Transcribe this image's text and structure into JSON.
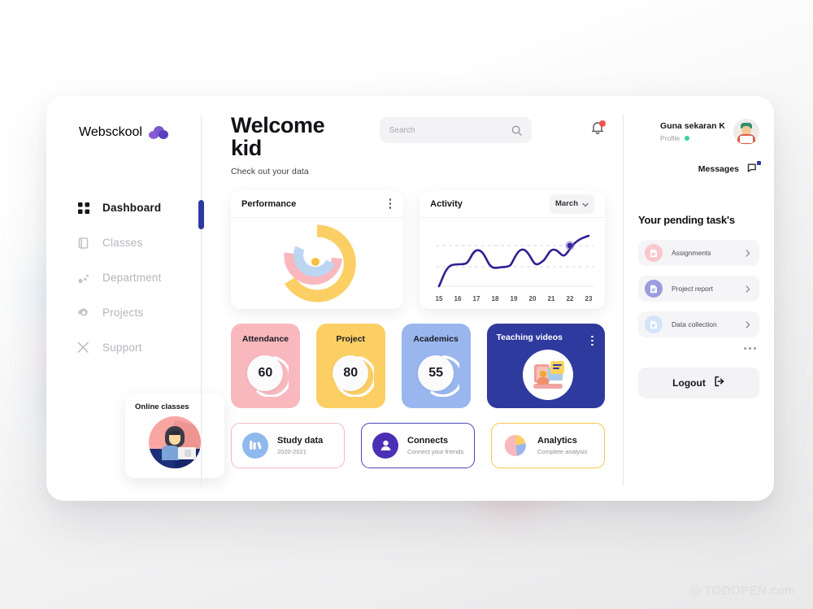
{
  "brand": {
    "name": "Websckool",
    "icon": "cloud-icon"
  },
  "sidebar": {
    "items": [
      {
        "label": "Dashboard",
        "icon": "grid-icon",
        "active": true
      },
      {
        "label": "Classes",
        "icon": "book-icon",
        "active": false
      },
      {
        "label": "Department",
        "icon": "dots-network-icon",
        "active": false
      },
      {
        "label": "Projects",
        "icon": "gear-icon",
        "active": false
      },
      {
        "label": "Support",
        "icon": "tools-icon",
        "active": false
      }
    ],
    "promo": {
      "title": "Online classes",
      "icon": "student-laptop-illustration"
    }
  },
  "header": {
    "title": "Welcome kid",
    "subtitle": "Check out your data",
    "search": {
      "placeholder": "Search",
      "value": "",
      "icon": "search-icon"
    },
    "notifications": {
      "icon": "bell-icon",
      "has_unread": true,
      "dot_color": "#f8544e"
    }
  },
  "performance": {
    "title": "Performance",
    "menu_icon": "kebab-menu-icon"
  },
  "activity": {
    "title": "Activity",
    "month": "March",
    "dropdown_icon": "chevron-down-icon"
  },
  "stats": [
    {
      "title": "Attendance",
      "value": "60",
      "bg": "#f8b8bd",
      "ring": "#ffffff"
    },
    {
      "title": "Project",
      "value": "80",
      "bg": "#fbcf64",
      "ring": "#ffffff"
    },
    {
      "title": "Academics",
      "value": "55",
      "bg": "#9ab6ef",
      "ring": "#ffffff"
    }
  ],
  "teaching": {
    "title": "Teaching videos",
    "bg": "#2f3a9e",
    "menu_icon": "kebab-menu-icon",
    "art": "video-lesson-illustration"
  },
  "links": [
    {
      "title": "Study data",
      "subtitle": "2020-2021",
      "icon": "books-icon",
      "border": "#f6b9c0",
      "icon_bg": "#8fb8ec"
    },
    {
      "title": "Connects",
      "subtitle": "Connect your friends",
      "icon": "user-icon",
      "border": "#4b45b8",
      "icon_bg": "#4b2fb5"
    },
    {
      "title": "Analytics",
      "subtitle": "Complete analysis",
      "icon": "pie-chart-icon",
      "border": "#f6c84c",
      "icon_bg": "transparent"
    }
  ],
  "profile": {
    "name": "Guna sekaran K",
    "role": "Profile",
    "online": true,
    "avatar": "avatar",
    "messages_label": "Messages",
    "messages_icon": "message-flag-icon"
  },
  "tasks": {
    "title": "Your pending task's",
    "items": [
      {
        "label": "Assignments",
        "icon": "document-icon",
        "icon_bg": "#f9c7cc",
        "chevron": "chevron-right-icon"
      },
      {
        "label": "Project report",
        "icon": "document-icon",
        "icon_bg": "#9b9ce0",
        "chevron": "chevron-right-icon"
      },
      {
        "label": "Data collection",
        "icon": "document-icon",
        "icon_bg": "#d3e3f8",
        "chevron": "chevron-right-icon"
      }
    ],
    "more_icon": "ellipsis-icon"
  },
  "logout": {
    "label": "Logout",
    "icon": "logout-icon"
  },
  "watermark": {
    "text": "TODOPEN.com",
    "mark": "@"
  },
  "chart_data": [
    {
      "type": "line",
      "title": "Activity",
      "x": [
        15,
        16,
        17,
        18,
        19,
        20,
        21,
        22,
        23
      ],
      "values": [
        2,
        33,
        52,
        32,
        62,
        44,
        68,
        84,
        92
      ],
      "xlabel": "",
      "ylabel": "",
      "ylim": [
        0,
        100
      ],
      "tick_labels": [
        "15",
        "16",
        "17",
        "18",
        "19",
        "20",
        "21",
        "22",
        "23"
      ],
      "grid": true,
      "line_color": "#2f2090",
      "highlight_point": {
        "x": 22,
        "y": 84
      },
      "legend": "none"
    },
    {
      "type": "pie",
      "title": "Performance",
      "series": [
        {
          "name": "outer",
          "color": "#fbcf64",
          "start_deg": 300,
          "sweep_deg": 240
        },
        {
          "name": "middle",
          "color": "#f8b8bd",
          "start_deg": 200,
          "sweep_deg": 175
        },
        {
          "name": "inner",
          "color": "#bcd6f2",
          "start_deg": 160,
          "sweep_deg": 190
        }
      ],
      "center_dot_color": "#fbbe3c"
    },
    {
      "type": "bar",
      "title": "Stat gauges",
      "categories": [
        "Attendance",
        "Project",
        "Academics"
      ],
      "values": [
        60,
        80,
        55
      ],
      "ylim": [
        0,
        100
      ]
    }
  ]
}
